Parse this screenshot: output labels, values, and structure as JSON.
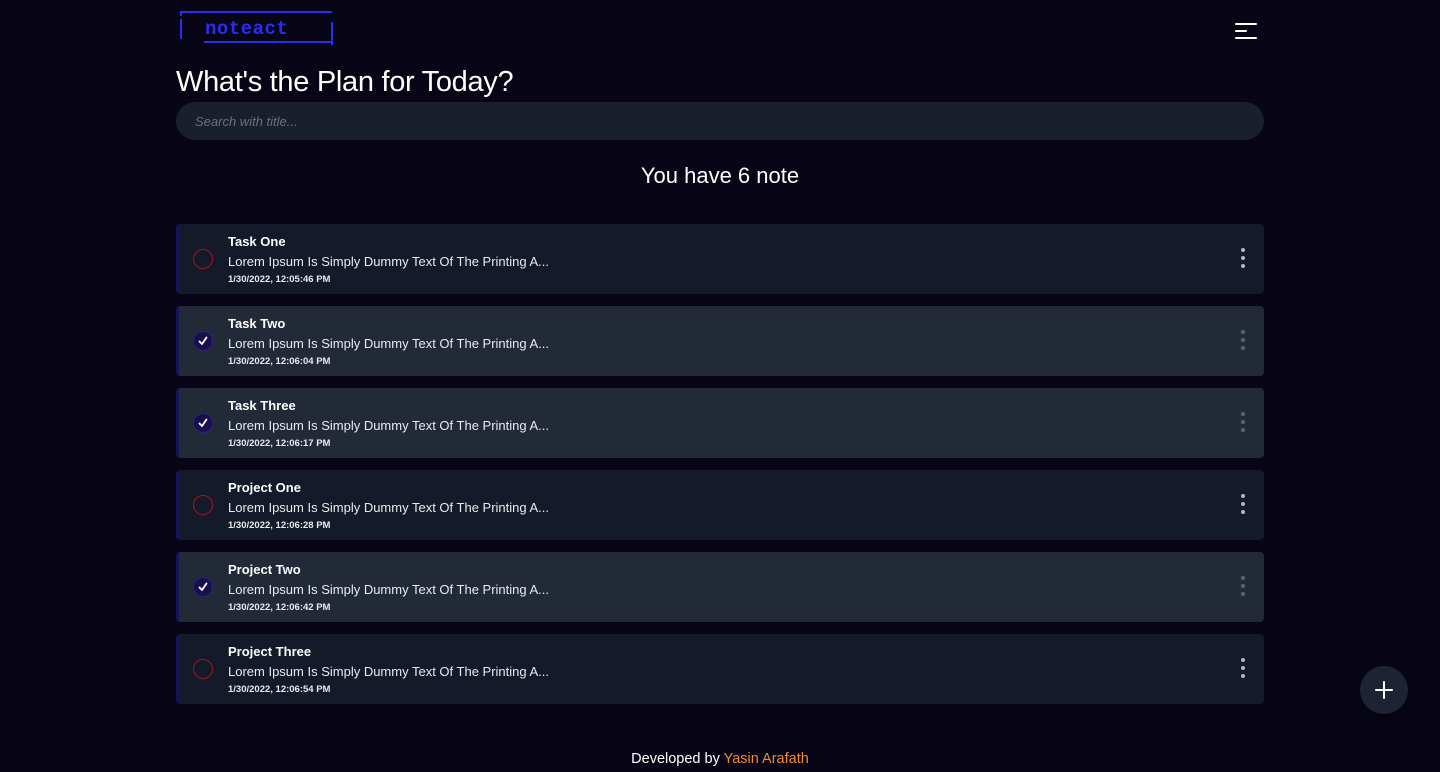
{
  "header": {
    "logo_text": "noteact",
    "menu_icon": "menu-icon"
  },
  "main": {
    "title": "What's the Plan for Today?",
    "search_placeholder": "Search with title...",
    "count_text": "You have 6 note"
  },
  "notes": [
    {
      "title": "Task One",
      "description": "Lorem Ipsum Is Simply Dummy Text Of The Printing A...",
      "time": "1/30/2022, 12:05:46 PM",
      "completed": false
    },
    {
      "title": "Task Two",
      "description": "Lorem Ipsum Is Simply Dummy Text Of The Printing A...",
      "time": "1/30/2022, 12:06:04 PM",
      "completed": true
    },
    {
      "title": "Task Three",
      "description": "Lorem Ipsum Is Simply Dummy Text Of The Printing A...",
      "time": "1/30/2022, 12:06:17 PM",
      "completed": true
    },
    {
      "title": "Project One",
      "description": "Lorem Ipsum Is Simply Dummy Text Of The Printing A...",
      "time": "1/30/2022, 12:06:28 PM",
      "completed": false
    },
    {
      "title": "Project Two",
      "description": "Lorem Ipsum Is Simply Dummy Text Of The Printing A...",
      "time": "1/30/2022, 12:06:42 PM",
      "completed": true
    },
    {
      "title": "Project Three",
      "description": "Lorem Ipsum Is Simply Dummy Text Of The Printing A...",
      "time": "1/30/2022, 12:06:54 PM",
      "completed": false
    }
  ],
  "fab": {
    "icon": "plus-icon"
  },
  "footer": {
    "prefix": "Developed by",
    "author": "Yasin Arafath"
  },
  "colors": {
    "background": "#080616",
    "card": "#141a29",
    "card_completed": "#232a37",
    "unchecked_ring": "#a0171d",
    "checked_fill": "#180f4f",
    "logo": "#2a2cf0",
    "author_link": "#f08a2c"
  }
}
